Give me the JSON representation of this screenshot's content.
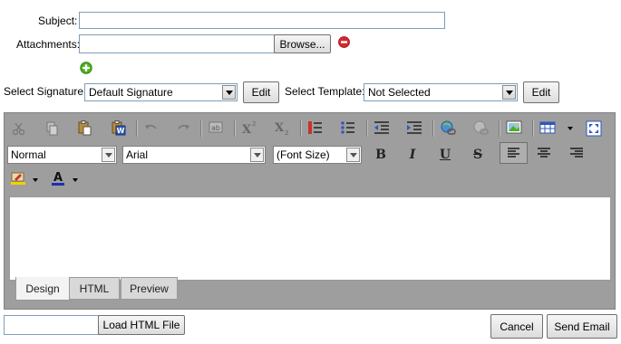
{
  "form": {
    "subject_label": "Subject:",
    "subject_value": "",
    "attachments_label": "Attachments:",
    "attachments_value": "",
    "browse_label": "Browse...",
    "signature_label": "Select Signature:",
    "signature_value": "Default Signature",
    "signature_edit": "Edit",
    "template_label": "Select Template:",
    "template_value": "Not Selected",
    "template_edit": "Edit"
  },
  "toolbar": {
    "row1_icons": [
      "cut-icon",
      "copy-icon",
      "paste-icon",
      "paste-word-icon",
      "undo-icon",
      "redo-icon",
      "spellcheck-icon",
      "superscript-icon",
      "subscript-icon",
      "ordered-list-icon",
      "unordered-list-icon",
      "outdent-icon",
      "indent-icon",
      "insert-link-icon",
      "remove-link-icon",
      "insert-image-icon",
      "insert-table-icon",
      "fullscreen-icon"
    ],
    "paragraph_format": "Normal",
    "font_name": "Arial",
    "font_size": "(Font Size)",
    "bold": "B",
    "italic": "I",
    "underline": "U",
    "strikethrough": "S"
  },
  "editor": {
    "content": "",
    "tabs": [
      "Design",
      "HTML",
      "Preview"
    ],
    "active_tab": "Design"
  },
  "footer": {
    "load_file_value": "",
    "load_html_label": "Load HTML File",
    "cancel_label": "Cancel",
    "send_label": "Send Email"
  },
  "colors": {
    "editor_bg": "#9e9e9e",
    "remove_icon": "#d9262b",
    "add_icon": "#4caf1f",
    "font_color_bar": "#1d2fb8"
  }
}
